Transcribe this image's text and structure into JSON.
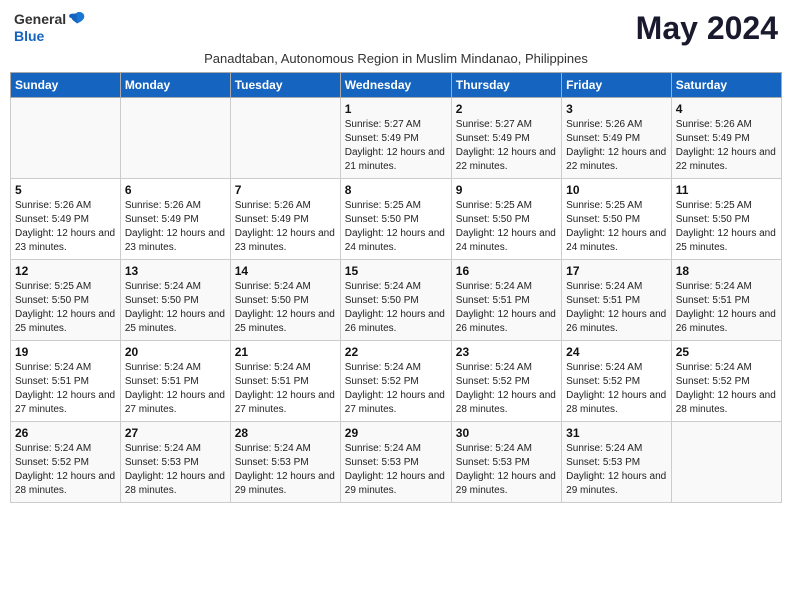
{
  "logo": {
    "text_general": "General",
    "text_blue": "Blue"
  },
  "title": "May 2024",
  "subtitle": "Panadtaban, Autonomous Region in Muslim Mindanao, Philippines",
  "weekdays": [
    "Sunday",
    "Monday",
    "Tuesday",
    "Wednesday",
    "Thursday",
    "Friday",
    "Saturday"
  ],
  "weeks": [
    [
      {
        "day": "",
        "info": ""
      },
      {
        "day": "",
        "info": ""
      },
      {
        "day": "",
        "info": ""
      },
      {
        "day": "1",
        "info": "Sunrise: 5:27 AM\nSunset: 5:49 PM\nDaylight: 12 hours and 21 minutes."
      },
      {
        "day": "2",
        "info": "Sunrise: 5:27 AM\nSunset: 5:49 PM\nDaylight: 12 hours and 22 minutes."
      },
      {
        "day": "3",
        "info": "Sunrise: 5:26 AM\nSunset: 5:49 PM\nDaylight: 12 hours and 22 minutes."
      },
      {
        "day": "4",
        "info": "Sunrise: 5:26 AM\nSunset: 5:49 PM\nDaylight: 12 hours and 22 minutes."
      }
    ],
    [
      {
        "day": "5",
        "info": "Sunrise: 5:26 AM\nSunset: 5:49 PM\nDaylight: 12 hours and 23 minutes."
      },
      {
        "day": "6",
        "info": "Sunrise: 5:26 AM\nSunset: 5:49 PM\nDaylight: 12 hours and 23 minutes."
      },
      {
        "day": "7",
        "info": "Sunrise: 5:26 AM\nSunset: 5:49 PM\nDaylight: 12 hours and 23 minutes."
      },
      {
        "day": "8",
        "info": "Sunrise: 5:25 AM\nSunset: 5:50 PM\nDaylight: 12 hours and 24 minutes."
      },
      {
        "day": "9",
        "info": "Sunrise: 5:25 AM\nSunset: 5:50 PM\nDaylight: 12 hours and 24 minutes."
      },
      {
        "day": "10",
        "info": "Sunrise: 5:25 AM\nSunset: 5:50 PM\nDaylight: 12 hours and 24 minutes."
      },
      {
        "day": "11",
        "info": "Sunrise: 5:25 AM\nSunset: 5:50 PM\nDaylight: 12 hours and 25 minutes."
      }
    ],
    [
      {
        "day": "12",
        "info": "Sunrise: 5:25 AM\nSunset: 5:50 PM\nDaylight: 12 hours and 25 minutes."
      },
      {
        "day": "13",
        "info": "Sunrise: 5:24 AM\nSunset: 5:50 PM\nDaylight: 12 hours and 25 minutes."
      },
      {
        "day": "14",
        "info": "Sunrise: 5:24 AM\nSunset: 5:50 PM\nDaylight: 12 hours and 25 minutes."
      },
      {
        "day": "15",
        "info": "Sunrise: 5:24 AM\nSunset: 5:50 PM\nDaylight: 12 hours and 26 minutes."
      },
      {
        "day": "16",
        "info": "Sunrise: 5:24 AM\nSunset: 5:51 PM\nDaylight: 12 hours and 26 minutes."
      },
      {
        "day": "17",
        "info": "Sunrise: 5:24 AM\nSunset: 5:51 PM\nDaylight: 12 hours and 26 minutes."
      },
      {
        "day": "18",
        "info": "Sunrise: 5:24 AM\nSunset: 5:51 PM\nDaylight: 12 hours and 26 minutes."
      }
    ],
    [
      {
        "day": "19",
        "info": "Sunrise: 5:24 AM\nSunset: 5:51 PM\nDaylight: 12 hours and 27 minutes."
      },
      {
        "day": "20",
        "info": "Sunrise: 5:24 AM\nSunset: 5:51 PM\nDaylight: 12 hours and 27 minutes."
      },
      {
        "day": "21",
        "info": "Sunrise: 5:24 AM\nSunset: 5:51 PM\nDaylight: 12 hours and 27 minutes."
      },
      {
        "day": "22",
        "info": "Sunrise: 5:24 AM\nSunset: 5:52 PM\nDaylight: 12 hours and 27 minutes."
      },
      {
        "day": "23",
        "info": "Sunrise: 5:24 AM\nSunset: 5:52 PM\nDaylight: 12 hours and 28 minutes."
      },
      {
        "day": "24",
        "info": "Sunrise: 5:24 AM\nSunset: 5:52 PM\nDaylight: 12 hours and 28 minutes."
      },
      {
        "day": "25",
        "info": "Sunrise: 5:24 AM\nSunset: 5:52 PM\nDaylight: 12 hours and 28 minutes."
      }
    ],
    [
      {
        "day": "26",
        "info": "Sunrise: 5:24 AM\nSunset: 5:52 PM\nDaylight: 12 hours and 28 minutes."
      },
      {
        "day": "27",
        "info": "Sunrise: 5:24 AM\nSunset: 5:53 PM\nDaylight: 12 hours and 28 minutes."
      },
      {
        "day": "28",
        "info": "Sunrise: 5:24 AM\nSunset: 5:53 PM\nDaylight: 12 hours and 29 minutes."
      },
      {
        "day": "29",
        "info": "Sunrise: 5:24 AM\nSunset: 5:53 PM\nDaylight: 12 hours and 29 minutes."
      },
      {
        "day": "30",
        "info": "Sunrise: 5:24 AM\nSunset: 5:53 PM\nDaylight: 12 hours and 29 minutes."
      },
      {
        "day": "31",
        "info": "Sunrise: 5:24 AM\nSunset: 5:53 PM\nDaylight: 12 hours and 29 minutes."
      },
      {
        "day": "",
        "info": ""
      }
    ]
  ]
}
